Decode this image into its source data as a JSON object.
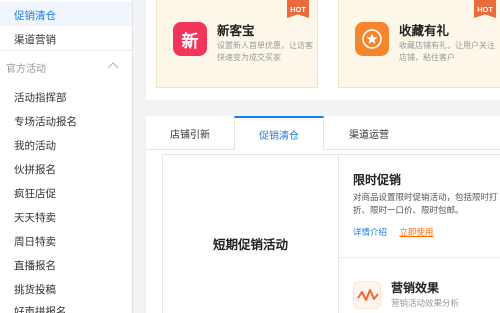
{
  "sidebar": {
    "top_items": [
      {
        "label": "促销清仓",
        "active": true
      },
      {
        "label": "渠道营销",
        "active": false
      }
    ],
    "section_title": "官方活动",
    "section_items": [
      "活动指挥部",
      "专场活动报名",
      "我的活动",
      "伙拼报名",
      "疯狂店促",
      "天天特卖",
      "周日特卖",
      "直播报名",
      "挑货投稿",
      "好声拼报名"
    ]
  },
  "promos": [
    {
      "title": "新客宝",
      "desc": "设置新人首单优惠，让访客快速变为成交买家",
      "badge": "HOT",
      "icon_char": "新",
      "icon_color": "#f4355b"
    },
    {
      "title": "收藏有礼",
      "desc": "收藏店铺有礼，让用户关注店铺，粘住客户",
      "badge": "HOT",
      "icon_char": "★",
      "icon_color": "#f5862e"
    }
  ],
  "tabs": [
    "店铺引新",
    "促销清仓",
    "渠道运营"
  ],
  "active_tab": "促销清仓",
  "content": {
    "section_title": "短期促销活动",
    "card": {
      "title": "限时促销",
      "desc": "对商品设置限时促销活动，包括限时打折、限时一口价、限时包邮。",
      "link_detail": "详情介绍",
      "link_use": "立即使用"
    },
    "effect": {
      "title": "营销效果",
      "desc": "营销活动效果分析",
      "icon": "wave-chart-icon"
    }
  },
  "colors": {
    "accent": "#1a7ee8",
    "hot": "#e96a3a",
    "link_use": "#ff6a00"
  }
}
